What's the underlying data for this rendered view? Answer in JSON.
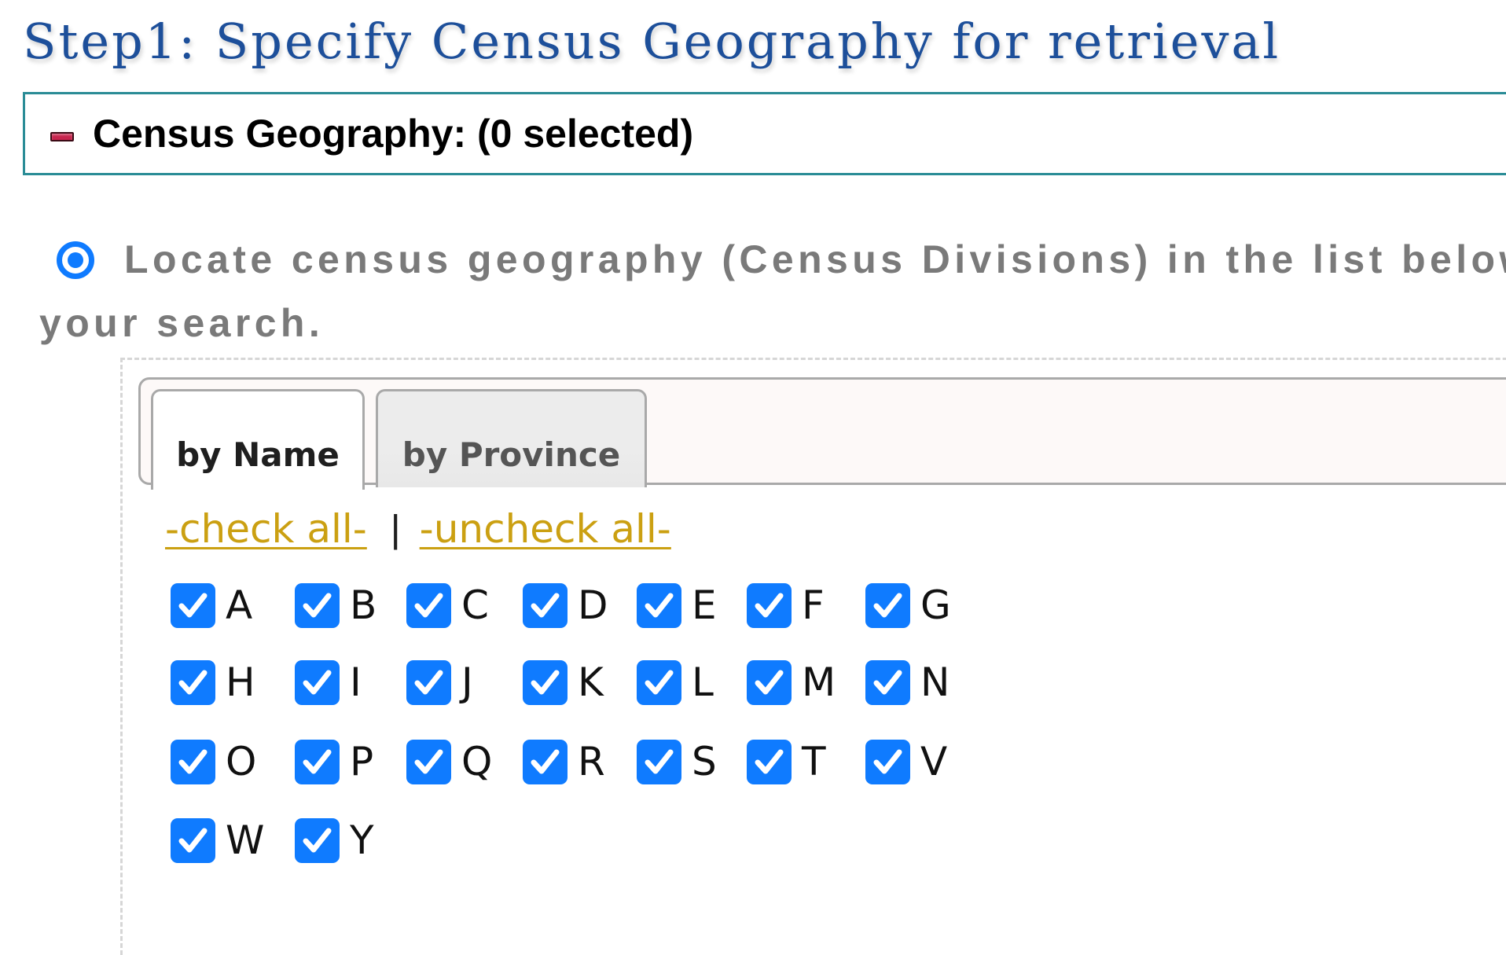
{
  "page": {
    "title": "Step1: Specify Census Geography for retrieval"
  },
  "geography_box": {
    "label": "Census Geography: (0 selected)",
    "toggle_icon": "minus-icon",
    "accent_color": "#2a8c96",
    "toggle_color": "#c7254e"
  },
  "locate_option": {
    "selected": true,
    "text": "Locate census geography (Census Divisions) in the list below to include in your search."
  },
  "tabs": [
    {
      "label": "by Name",
      "active": true
    },
    {
      "label": "by Province",
      "active": false
    }
  ],
  "links": {
    "check_all": "-check all-",
    "separator": "|",
    "uncheck_all": "-uncheck all-",
    "color": "#cba012"
  },
  "checkbox_color": "#0f7bff",
  "letters": [
    {
      "label": "A",
      "checked": true
    },
    {
      "label": "B",
      "checked": true
    },
    {
      "label": "C",
      "checked": true
    },
    {
      "label": "D",
      "checked": true
    },
    {
      "label": "E",
      "checked": true
    },
    {
      "label": "F",
      "checked": true
    },
    {
      "label": "G",
      "checked": true
    },
    {
      "label": "H",
      "checked": true
    },
    {
      "label": "I",
      "checked": true
    },
    {
      "label": "J",
      "checked": true
    },
    {
      "label": "K",
      "checked": true
    },
    {
      "label": "L",
      "checked": true
    },
    {
      "label": "M",
      "checked": true
    },
    {
      "label": "N",
      "checked": true
    },
    {
      "label": "O",
      "checked": true
    },
    {
      "label": "P",
      "checked": true
    },
    {
      "label": "Q",
      "checked": true
    },
    {
      "label": "R",
      "checked": true
    },
    {
      "label": "S",
      "checked": true
    },
    {
      "label": "T",
      "checked": true
    },
    {
      "label": "V",
      "checked": true
    },
    {
      "label": "W",
      "checked": true
    },
    {
      "label": "Y",
      "checked": true
    }
  ]
}
